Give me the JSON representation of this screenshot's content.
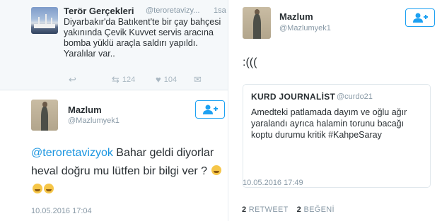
{
  "tweet_top": {
    "name": "Terör Gerçekleri",
    "handle": "@teroretavizy...",
    "time": "1sa",
    "text": "Diyarbakır'da Batıkent'te bir çay bahçesi yakınında Çevik Kuvvet servis aracına bomba yüklü araçla saldırı yapıldı. Yaralılar var..",
    "retweets": "124",
    "likes": "104",
    "icons": [
      "reply-icon",
      "retweet-icon",
      "like-icon",
      "message-icon"
    ]
  },
  "reply_tweet": {
    "name": "Mazlum",
    "handle": "@Mazlumyek1",
    "mention": "@teroretavizyok",
    "text": "Bahar geldi diyorlar heval doğru mu  lütfen bir bilgi ver ?",
    "date": "10.05.2016 17:04",
    "follow_icon": "add-user-icon"
  },
  "right_tweet": {
    "name": "Mazlum",
    "handle": "@Mazlumyek1",
    "text": ":(((",
    "follow_icon": "add-user-icon",
    "quote": {
      "name": "KURD JOURNALİST",
      "handle": "@curdo21",
      "text": "Amedteki patlamada dayım ve oğlu ağır yaralandı ayrıca halamin torunu bacağı koptu durumu kritik #KahpeSaray"
    },
    "date": "10.05.2016 17:49",
    "retweet_count": "2",
    "retweet_label": "RETWEET",
    "like_count": "2",
    "like_label": "BEĞENİ"
  },
  "colors": {
    "accent": "#1da1f2",
    "mention": "#1b95e0",
    "muted": "#8899a6",
    "text": "#292f33",
    "top_bg": "#f5f8fa"
  }
}
